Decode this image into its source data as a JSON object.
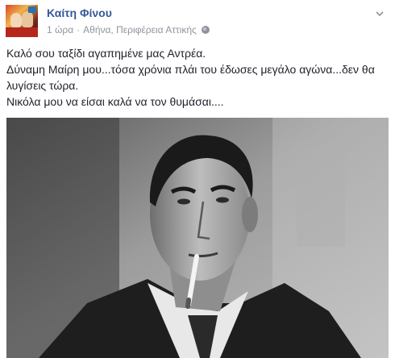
{
  "post": {
    "author": "Καίτη Φίνου",
    "time": "1 ώρα",
    "separator": "·",
    "location": "Αθήνα, Περιφέρεια Αττικής",
    "privacy_icon": "globe-icon",
    "menu_icon": "chevron-down-icon",
    "lines": [
      "Καλό σου ταξίδι αγαπημένε μας Αντρέα.",
      "Δύναμη Μαίρη μου...τόσα χρόνια πλάι του έδωσες μεγάλο αγώνα...δεν θα λυγίσεις τώρα.",
      "Νικόλα μου να είσαι καλά να τον θυμάσαι...."
    ]
  },
  "colors": {
    "author_link": "#365899",
    "meta_text": "#90949c",
    "body_text": "#1d2129"
  }
}
